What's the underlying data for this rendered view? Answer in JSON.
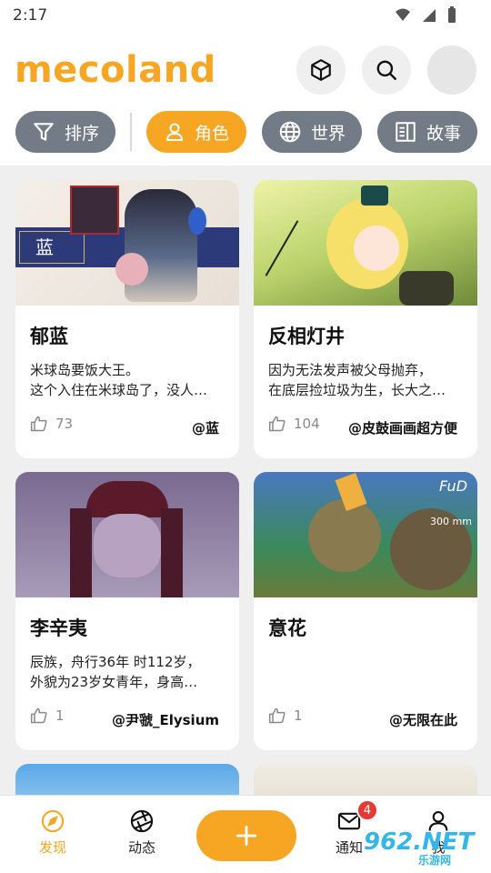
{
  "status_bar": {
    "time": "2:17"
  },
  "header": {
    "logo": "mecoland"
  },
  "filters": [
    {
      "label": "排序",
      "icon": "filter-icon",
      "active": false
    },
    {
      "label": "角色",
      "icon": "person-icon",
      "active": true
    },
    {
      "label": "世界",
      "icon": "globe-icon",
      "active": false
    },
    {
      "label": "故事",
      "icon": "book-icon",
      "active": false
    }
  ],
  "cards": [
    {
      "title": "郁蓝",
      "desc_line1": "米球岛要饭大王。",
      "desc_line2": "这个入住在米球岛了，没人…",
      "likes": "73",
      "author": "@蓝",
      "image_label": "蓝"
    },
    {
      "title": "反相灯井",
      "desc_line1": "因为无法发声被父母抛弃，",
      "desc_line2": "在底层捡垃圾为生，长大之…",
      "likes": "104",
      "author": "@皮鼓画画超方便"
    },
    {
      "title": "李辛夷",
      "desc_line1": "辰族，舟行36年 时112岁，",
      "desc_line2": "外貌为23岁女青年，身高…",
      "likes": "1",
      "author": "@尹虢_Elysium"
    },
    {
      "title": "意花",
      "desc_line1": "",
      "desc_line2": "",
      "likes": "1",
      "author": "@无限在此",
      "image_label": "FuD",
      "image_label2": "300 mm"
    }
  ],
  "bottom_nav": {
    "discover": "发现",
    "activity": "动态",
    "notifications": "通知",
    "notification_count": "4",
    "me": "我"
  },
  "watermark": {
    "text": "962.NET",
    "sub": "乐游网"
  },
  "colors": {
    "accent": "#f6a623",
    "chip_gray": "#727b86",
    "badge": "#e53935"
  }
}
